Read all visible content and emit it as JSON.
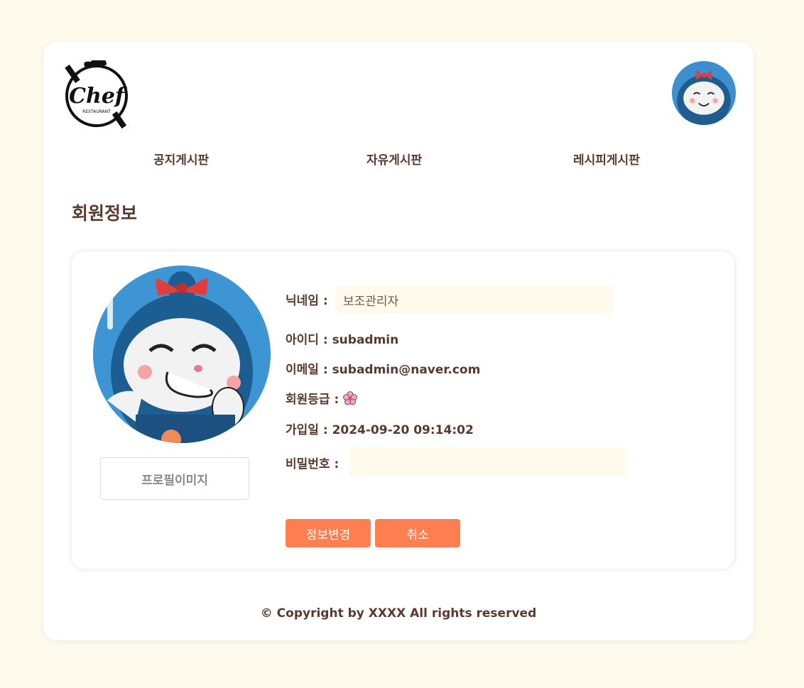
{
  "header": {
    "logo_text": "Chef",
    "logo_subtext": "RESTAURANT"
  },
  "nav": {
    "items": [
      {
        "label": "공지게시판"
      },
      {
        "label": "자유게시판"
      },
      {
        "label": "레시피게시판"
      }
    ]
  },
  "page": {
    "title": "회원정보"
  },
  "profile": {
    "image_button_label": "프로필이미지",
    "nickname_label": "닉네임 :",
    "nickname_value": "보조관리자",
    "id_label": "아이디 :",
    "id_value": "subadmin",
    "email_label": "이메일 :",
    "email_value": "subadmin@naver.com",
    "grade_label": "회원등급 :",
    "grade_icon": "cherry-blossom-icon",
    "joined_label": "가입일 :",
    "joined_value": "2024-09-20 09:14:02",
    "password_label": "비밀번호 :",
    "password_value": ""
  },
  "actions": {
    "update_label": "정보변경",
    "cancel_label": "취소"
  },
  "footer": {
    "text": "© Copyright by XXXX All rights reserved"
  },
  "colors": {
    "accent": "#ff7f50",
    "background": "#fefaec",
    "text": "#5a3a2e",
    "input_bg": "#fffaeb"
  }
}
